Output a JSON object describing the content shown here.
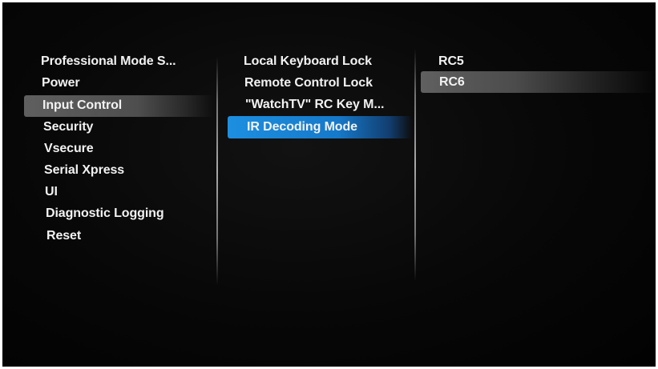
{
  "column1": {
    "items": [
      "Professional Mode S...",
      "Power",
      "Input Control",
      "Security",
      "Vsecure",
      "Serial Xpress",
      "UI",
      "Diagnostic Logging",
      "Reset"
    ],
    "selected": "Input Control"
  },
  "column2": {
    "items": [
      "Local Keyboard Lock",
      "Remote Control Lock",
      "\"WatchTV\" RC Key M...",
      "IR Decoding Mode"
    ],
    "focused": "IR Decoding Mode"
  },
  "column3": {
    "items": [
      "RC5",
      "RC6"
    ],
    "selected": "RC6"
  },
  "colors": {
    "background": "#050505",
    "text": "#f2f2f2",
    "selection_gray": "#5a5a5a",
    "focus_blue": "#1d8fe0"
  }
}
